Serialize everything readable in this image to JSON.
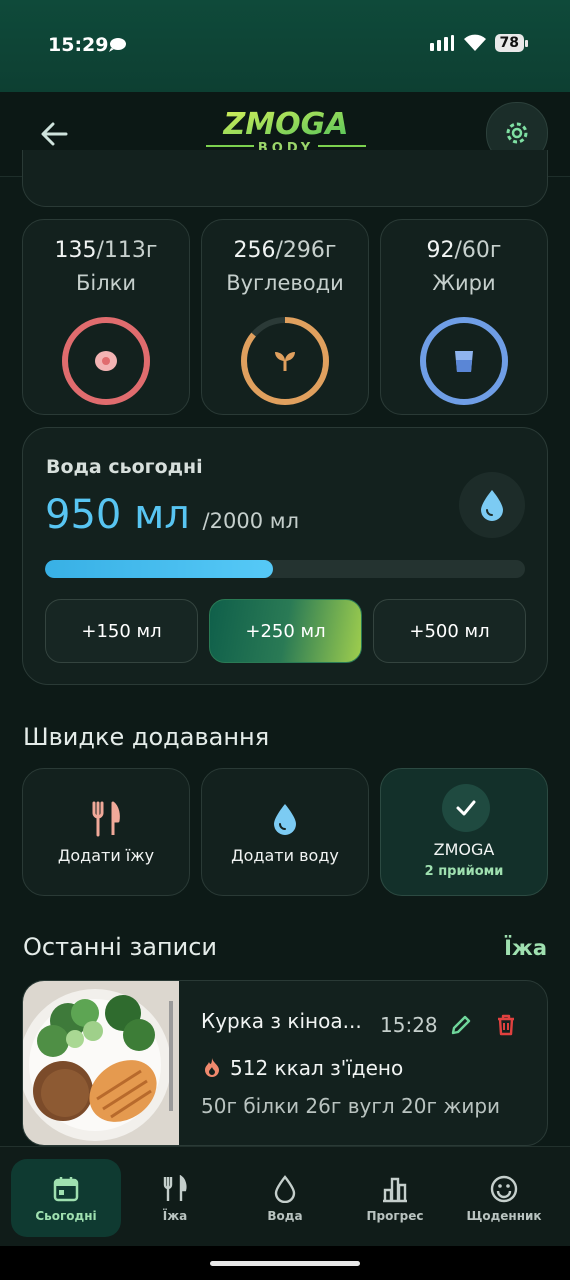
{
  "status_bar": {
    "time": "15:29",
    "battery": "78"
  },
  "header": {
    "logo_text": "ZMOGA",
    "logo_subtext": "BODY"
  },
  "macros": [
    {
      "name": "protein",
      "consumed": "135",
      "target": "/113г",
      "label": "Білки",
      "progress": 1.0,
      "color": "#e06c6e"
    },
    {
      "name": "carbs",
      "consumed": "256",
      "target": "/296г",
      "label": "Вуглеводи",
      "progress": 0.86,
      "color": "#e0a05e"
    },
    {
      "name": "fat",
      "consumed": "92",
      "target": "/60г",
      "label": "Жири",
      "progress": 1.0,
      "color": "#6f9ee6"
    }
  ],
  "water": {
    "title": "Вода сьогодні",
    "amount": "950 мл",
    "goal": "/2000 мл",
    "progress": 0.475,
    "buttons": [
      "+150 мл",
      "+250 мл",
      "+500 мл"
    ],
    "active_button": 1
  },
  "quick_add": {
    "title": "Швидке додавання",
    "items": [
      {
        "label": "Додати їжу",
        "icon": "fork-knife-icon"
      },
      {
        "label": "Додати воду",
        "icon": "water-drop-icon"
      },
      {
        "label": "ZMOGA",
        "sublabel": "2 прийоми",
        "icon": "check-icon"
      }
    ]
  },
  "recent": {
    "title": "Останні записи",
    "link": "Їжа",
    "entries": [
      {
        "name": "Курка з кіноа...",
        "time": "15:28",
        "kcal": "512 ккал з'їдено",
        "macros": "50г білки 26г вугл 20г жири"
      }
    ]
  },
  "bottom_nav": [
    {
      "label": "Сьогодні",
      "icon": "calendar-icon",
      "active": true
    },
    {
      "label": "Їжа",
      "icon": "fork-knife-icon",
      "active": false
    },
    {
      "label": "Вода",
      "icon": "water-drop-icon",
      "active": false
    },
    {
      "label": "Прогрес",
      "icon": "bar-chart-icon",
      "active": false
    },
    {
      "label": "Щоденник",
      "icon": "smiley-icon",
      "active": false
    }
  ]
}
